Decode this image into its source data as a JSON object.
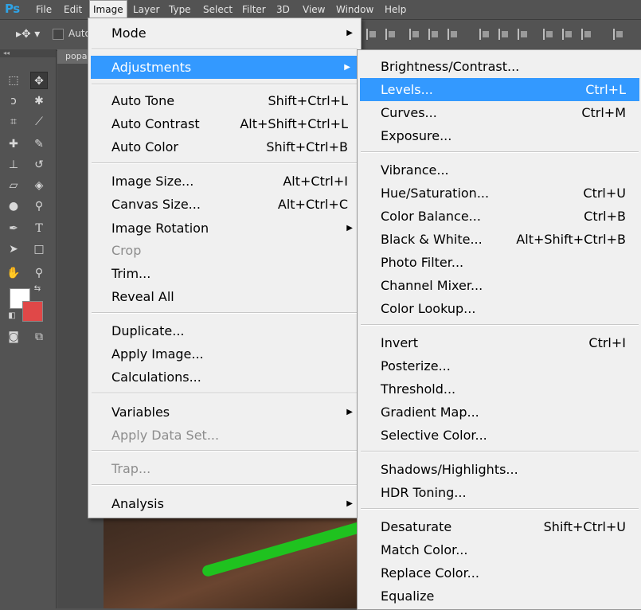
{
  "menubar": {
    "logo": "Ps",
    "items": [
      {
        "label": "File"
      },
      {
        "label": "Edit"
      },
      {
        "label": "Image"
      },
      {
        "label": "Layer"
      },
      {
        "label": "Type"
      },
      {
        "label": "Select"
      },
      {
        "label": "Filter"
      },
      {
        "label": "3D"
      },
      {
        "label": "View"
      },
      {
        "label": "Window"
      },
      {
        "label": "Help"
      }
    ]
  },
  "options": {
    "auto_label": "Auto"
  },
  "document": {
    "tab_label": "popa"
  },
  "image_menu": {
    "items": [
      {
        "label": "Mode",
        "shortcut": "",
        "submenu": true
      },
      {
        "label": "Adjustments",
        "shortcut": "",
        "submenu": true
      },
      {
        "label": "Auto Tone",
        "shortcut": "Shift+Ctrl+L"
      },
      {
        "label": "Auto Contrast",
        "shortcut": "Alt+Shift+Ctrl+L"
      },
      {
        "label": "Auto Color",
        "shortcut": "Shift+Ctrl+B"
      },
      {
        "label": "Image Size...",
        "shortcut": "Alt+Ctrl+I"
      },
      {
        "label": "Canvas Size...",
        "shortcut": "Alt+Ctrl+C"
      },
      {
        "label": "Image Rotation",
        "shortcut": "",
        "submenu": true
      },
      {
        "label": "Crop",
        "shortcut": "",
        "disabled": true
      },
      {
        "label": "Trim...",
        "shortcut": ""
      },
      {
        "label": "Reveal All",
        "shortcut": ""
      },
      {
        "label": "Duplicate...",
        "shortcut": ""
      },
      {
        "label": "Apply Image...",
        "shortcut": ""
      },
      {
        "label": "Calculations...",
        "shortcut": ""
      },
      {
        "label": "Variables",
        "shortcut": "",
        "submenu": true
      },
      {
        "label": "Apply Data Set...",
        "shortcut": "",
        "disabled": true
      },
      {
        "label": "Trap...",
        "shortcut": "",
        "disabled": true
      },
      {
        "label": "Analysis",
        "shortcut": "",
        "submenu": true
      }
    ]
  },
  "adjustments_menu": {
    "items": [
      {
        "label": "Brightness/Contrast...",
        "shortcut": ""
      },
      {
        "label": "Levels...",
        "shortcut": "Ctrl+L"
      },
      {
        "label": "Curves...",
        "shortcut": "Ctrl+M"
      },
      {
        "label": "Exposure...",
        "shortcut": ""
      },
      {
        "label": "Vibrance...",
        "shortcut": ""
      },
      {
        "label": "Hue/Saturation...",
        "shortcut": "Ctrl+U"
      },
      {
        "label": "Color Balance...",
        "shortcut": "Ctrl+B"
      },
      {
        "label": "Black & White...",
        "shortcut": "Alt+Shift+Ctrl+B"
      },
      {
        "label": "Photo Filter...",
        "shortcut": ""
      },
      {
        "label": "Channel Mixer...",
        "shortcut": ""
      },
      {
        "label": "Color Lookup...",
        "shortcut": ""
      },
      {
        "label": "Invert",
        "shortcut": "Ctrl+I"
      },
      {
        "label": "Posterize...",
        "shortcut": ""
      },
      {
        "label": "Threshold...",
        "shortcut": ""
      },
      {
        "label": "Gradient Map...",
        "shortcut": ""
      },
      {
        "label": "Selective Color...",
        "shortcut": ""
      },
      {
        "label": "Shadows/Highlights...",
        "shortcut": ""
      },
      {
        "label": "HDR Toning...",
        "shortcut": ""
      },
      {
        "label": "Desaturate",
        "shortcut": "Shift+Ctrl+U"
      },
      {
        "label": "Match Color...",
        "shortcut": ""
      },
      {
        "label": "Replace Color...",
        "shortcut": ""
      },
      {
        "label": "Equalize",
        "shortcut": ""
      }
    ]
  },
  "colors": {
    "highlight": "#3399ff",
    "menu_bg": "#f0f0f0",
    "ui_bg": "#535353",
    "foreground_swatch": "#ffffff",
    "background_swatch": "#e04848"
  }
}
